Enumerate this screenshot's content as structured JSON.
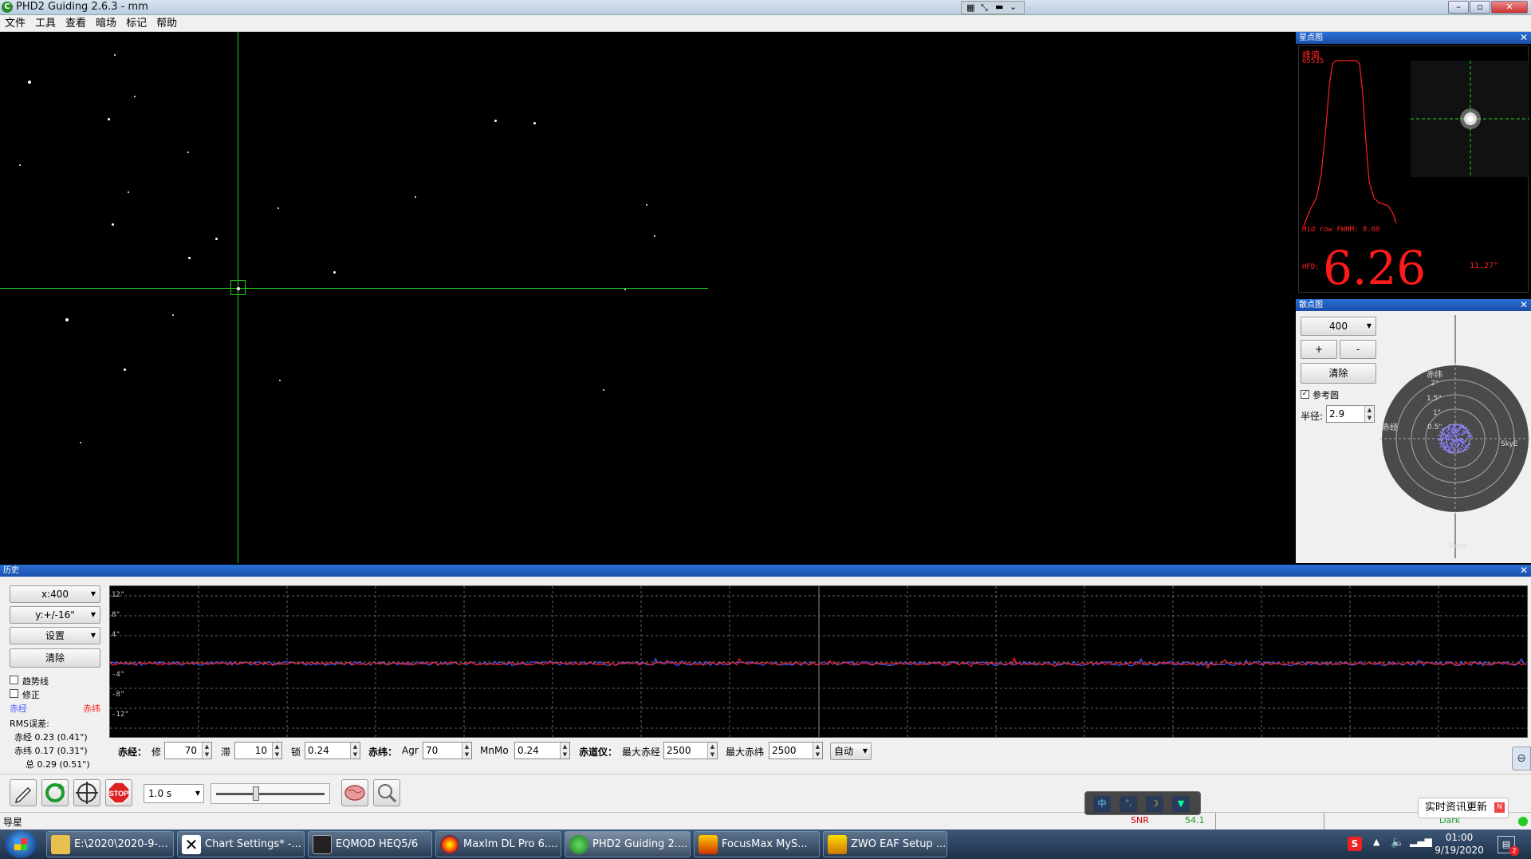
{
  "window": {
    "title": "PHD2 Guiding 2.6.3 - mm",
    "icon_letter": "C"
  },
  "menu": [
    "文件",
    "工具",
    "查看",
    "暗场",
    "标记",
    "帮助"
  ],
  "profile_pane": {
    "title": "星点图",
    "peak_label": "峰值",
    "peak_value": "65535",
    "fwhm_text": "Mid row FWHM: 8.60",
    "hfd_label": "HFD:",
    "hfd_value": "6.26",
    "hfd_arcsec": "11.27\""
  },
  "scatter_pane": {
    "title": "散点图",
    "scale_select": "400",
    "plus": "+",
    "minus": "-",
    "clear": "清除",
    "ref_circle_label": "参考圆",
    "radius_label": "半径:",
    "radius_value": "2.9",
    "rings": [
      "2\"",
      "1.5\"",
      "1\"",
      "0.5\""
    ],
    "label_dec": "赤纬",
    "label_ra": "赤经",
    "label_skye": "SkyE",
    "label_skyn": "SkyN"
  },
  "history_pane": {
    "title": "历史",
    "x_select": "x:400",
    "y_select": "y:+/-16\"",
    "settings_select": "设置",
    "clear": "清除",
    "trend_label": "趋势线",
    "correction_label": "修正",
    "ra_legend": "赤经",
    "dec_legend": "赤纬",
    "rms_title": "RMS误差:",
    "rms_ra": "赤经 0.23 (0.41\")",
    "rms_dec": "赤纬 0.17 (0.31\")",
    "rms_total": "总 0.29 (0.51\")",
    "y_ticks": [
      "12\"",
      "8\"",
      "4\"",
      "-4\"",
      "-8\"",
      "-12\""
    ]
  },
  "controls": {
    "ra_label": "赤经：",
    "ra_hyst_label": "修",
    "ra_hyst_value": "70",
    "ra_agg_label": "滞",
    "ra_agg_value": "10",
    "ra_min_label": "锁",
    "ra_min_value": "0.24",
    "dec_label": "赤纬：",
    "dec_agr_label": "Agr",
    "dec_agr_value": "70",
    "dec_minmo_label": "MnMo",
    "dec_minmo_value": "0.24",
    "mount_label": "赤道仪：",
    "max_ra_label": "最大赤经",
    "max_ra_value": "2500",
    "max_dec_label": "最大赤纬",
    "max_dec_value": "2500",
    "mode_select": "自动"
  },
  "toolbar": {
    "exposure": "1.0 s",
    "stop_label": "STOP"
  },
  "status": {
    "left": "导星",
    "dark": "Dark",
    "snr": "SNR",
    "snr_value": "54.1"
  },
  "floating": {
    "news": "实时资讯更新"
  },
  "taskbar": {
    "tasks": [
      "E:\\2020\\2020-9-...",
      "Chart Settings* -...",
      "EQMOD HEQ5/6",
      "MaxIm DL Pro 6....",
      "PHD2 Guiding 2....",
      "FocusMax   MyS...",
      "ZWO EAF Setup ..."
    ],
    "time": "01:00",
    "date": "9/19/2020"
  },
  "colors": {
    "ra": "#4a5cff",
    "dec": "#ff2020",
    "crosshair": "#1fd21f",
    "hfd": "#ff1a1a",
    "pane_header": "#1a4fa8"
  }
}
